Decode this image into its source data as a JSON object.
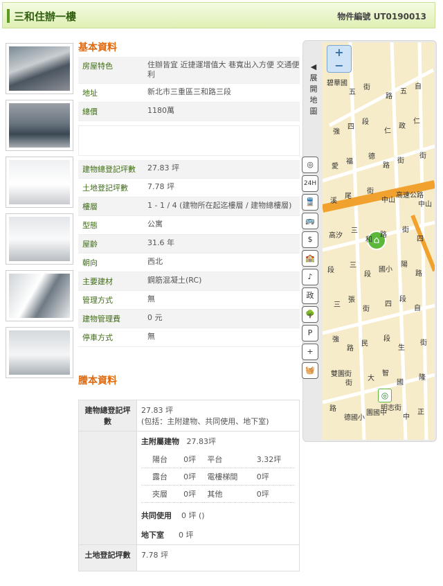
{
  "header": {
    "title": "三和住辦一樓",
    "id_label": "物件編號",
    "id_value": "UT0190013"
  },
  "thumbs": [
    {
      "name": "photo-street"
    },
    {
      "name": "photo-gate"
    },
    {
      "name": "photo-room-empty"
    },
    {
      "name": "photo-room-window"
    },
    {
      "name": "photo-window"
    },
    {
      "name": "photo-bathroom"
    }
  ],
  "sections": {
    "basic": "基本資料",
    "register": "謄本資料"
  },
  "basic": {
    "features_k": "房屋特色",
    "features_v": "住辦皆宜 近捷運增值大 巷寬出入方便 交通便利",
    "address_k": "地址",
    "address_v": "新北市三重區三和路三段",
    "price_k": "總價",
    "price_v": "1180萬"
  },
  "details": [
    {
      "k": "建物總登記坪數",
      "v": "27.83 坪"
    },
    {
      "k": "土地登記坪數",
      "v": "7.78 坪"
    },
    {
      "k": "樓層",
      "v": "1 - 1 / 4 (建物所在起迄樓層 / 建物總樓層)"
    },
    {
      "k": "型態",
      "v": "公寓"
    },
    {
      "k": "屋齡",
      "v": "31.6 年"
    },
    {
      "k": "朝向",
      "v": "西北"
    },
    {
      "k": "主要建材",
      "v": "鋼筋混凝土(RC)"
    },
    {
      "k": "管理方式",
      "v": "無"
    },
    {
      "k": "建物管理費",
      "v": "0 元"
    },
    {
      "k": "停車方式",
      "v": "無"
    }
  ],
  "map": {
    "tab_label": "展開地圖",
    "streets": [
      "碧華國",
      "五",
      "街",
      "路",
      "五",
      "自",
      "強",
      "四",
      "段",
      "仁",
      "政",
      "仁",
      "愛",
      "福",
      "德",
      "路",
      "街",
      "街",
      "溪",
      "尾",
      "街",
      "中山",
      "高速公路",
      "中山",
      "高汐",
      "三",
      "和",
      "路",
      "街",
      "四",
      "段",
      "三",
      "段",
      "國小",
      "陽",
      "路",
      "三",
      "張",
      "街",
      "四",
      "段",
      "自",
      "強",
      "路",
      "民",
      "段",
      "生",
      "街",
      "雙園街",
      "街",
      "大",
      "智",
      "國",
      "隆",
      "路",
      "德國小",
      "園國中",
      "明志街",
      "中",
      "正"
    ]
  },
  "poi_icons": [
    {
      "name": "landmark-icon",
      "glyph": "◎"
    },
    {
      "name": "24h-icon",
      "glyph": "24H"
    },
    {
      "name": "train-icon",
      "glyph": "🚆"
    },
    {
      "name": "bus-icon",
      "glyph": "🚌"
    },
    {
      "name": "bank-icon",
      "glyph": "$"
    },
    {
      "name": "school-icon",
      "glyph": "🏫"
    },
    {
      "name": "music-icon",
      "glyph": "♪"
    },
    {
      "name": "government-icon",
      "glyph": "政"
    },
    {
      "name": "park-icon",
      "glyph": "🌳"
    },
    {
      "name": "parking-icon",
      "glyph": "P"
    },
    {
      "name": "hospital-icon",
      "glyph": "+"
    },
    {
      "name": "market-icon",
      "glyph": "🧺"
    }
  ],
  "register": {
    "bldg_head": "建物總登記坪數",
    "bldg_val": "27.83 坪",
    "bldg_note": "(包括：主附建物、共同使用、地下室)",
    "main_label": "主附屬建物",
    "main_val": "27.83坪",
    "sub": [
      [
        "陽台",
        "0坪",
        "平台",
        "3.32坪"
      ],
      [
        "露台",
        "0坪",
        "電樓梯間",
        "0坪"
      ],
      [
        "夾層",
        "0坪",
        "其他",
        "0坪"
      ]
    ],
    "common_label": "共同使用",
    "common_val": "0 坪 ()",
    "basement_label": "地下室",
    "basement_val": "0 坪",
    "land_head": "土地登記坪數",
    "land_val": "7.78 坪"
  }
}
